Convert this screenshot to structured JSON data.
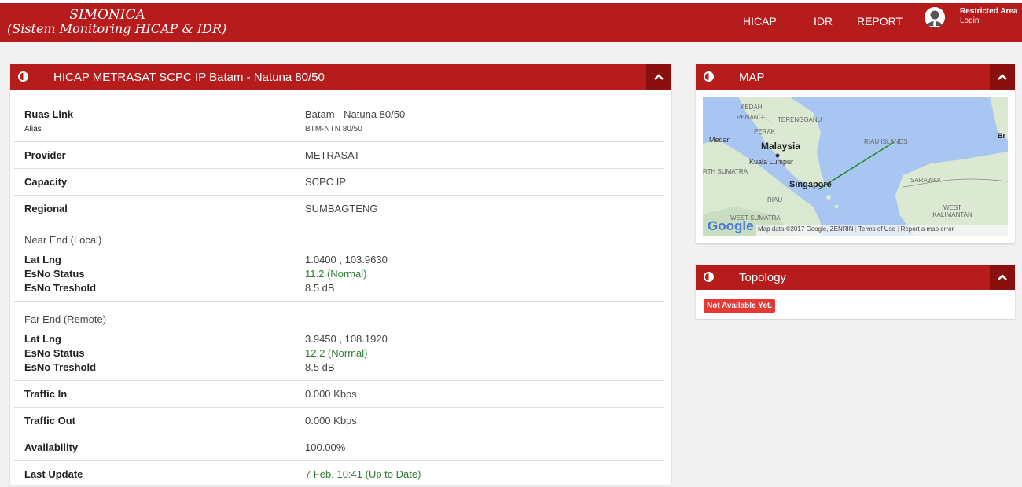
{
  "brand": {
    "title": "SIMONICA",
    "subtitle": "(Sistem Monitoring HICAP & IDR)"
  },
  "nav": {
    "items": [
      "HICAP",
      "IDR",
      "REPORT"
    ],
    "restricted_label": "Restricted Area",
    "login_label": "Login"
  },
  "detail_panel": {
    "title": "HICAP METRASAT SCPC IP Batam - Natuna 80/50",
    "ruas_link_label": "Ruas Link",
    "ruas_link_value": "Batam - Natuna 80/50",
    "alias_label": "Alias",
    "alias_value": "BTM-NTN 80/50",
    "provider_label": "Provider",
    "provider_value": "METRASAT",
    "capacity_label": "Capacity",
    "capacity_value": "SCPC IP",
    "regional_label": "Regional",
    "regional_value": "SUMBAGTENG",
    "near_end": {
      "heading": "Near End (Local)",
      "latlng_label": "Lat Lng",
      "latlng_value": "1.0400 , 103.9630",
      "esno_status_label": "EsNo Status",
      "esno_status_value": "11.2 (Normal)",
      "esno_threshold_label": "EsNo Treshold",
      "esno_threshold_value": "8.5 dB"
    },
    "far_end": {
      "heading": "Far End (Remote)",
      "latlng_label": "Lat Lng",
      "latlng_value": "3.9450 , 108.1920",
      "esno_status_label": "EsNo Status",
      "esno_status_value": "12.2 (Normal)",
      "esno_threshold_label": "EsNo Treshold",
      "esno_threshold_value": "8.5 dB"
    },
    "traffic_in_label": "Traffic In",
    "traffic_in_value": "0.000 Kbps",
    "traffic_out_label": "Traffic Out",
    "traffic_out_value": "0.000 Kbps",
    "availability_label": "Availability",
    "availability_value": "100.00%",
    "last_update_label": "Last Update",
    "last_update_value": "7 Feb, 10:41 (Up to Date)"
  },
  "map_panel": {
    "title": "MAP",
    "labels": {
      "kedah": "KEDAH",
      "penang": "PENANG",
      "terengganu": "TERENGGANU",
      "perak": "PERAK",
      "medan": "Medan",
      "malaysia": "Malaysia",
      "kuala_lumpur": "Kuala Lumpur",
      "north_sumatra": "RTH SUMATRA",
      "singapore": "Singapore",
      "riau": "RIAU",
      "riau_islands": "RIAU ISLANDS",
      "sarawak": "SARAWAK",
      "west_kalimantan": "WEST KALIMANTAN",
      "west_sumatra": "WEST SUMATRA",
      "br": "Br"
    },
    "google_logo": "Google",
    "attribution": "Map data ©2017 Google, ZENRIN",
    "terms": "Terms of Use",
    "report": "Report a map error"
  },
  "topology_panel": {
    "title": "Topology",
    "status_badge": "Not Available Yet."
  },
  "colors": {
    "brand_red": "#b71c1c",
    "collapse_red": "#8a1010",
    "badge_red": "#e53935",
    "status_green": "#2e7d32",
    "link_line": "#1b8a1b"
  }
}
